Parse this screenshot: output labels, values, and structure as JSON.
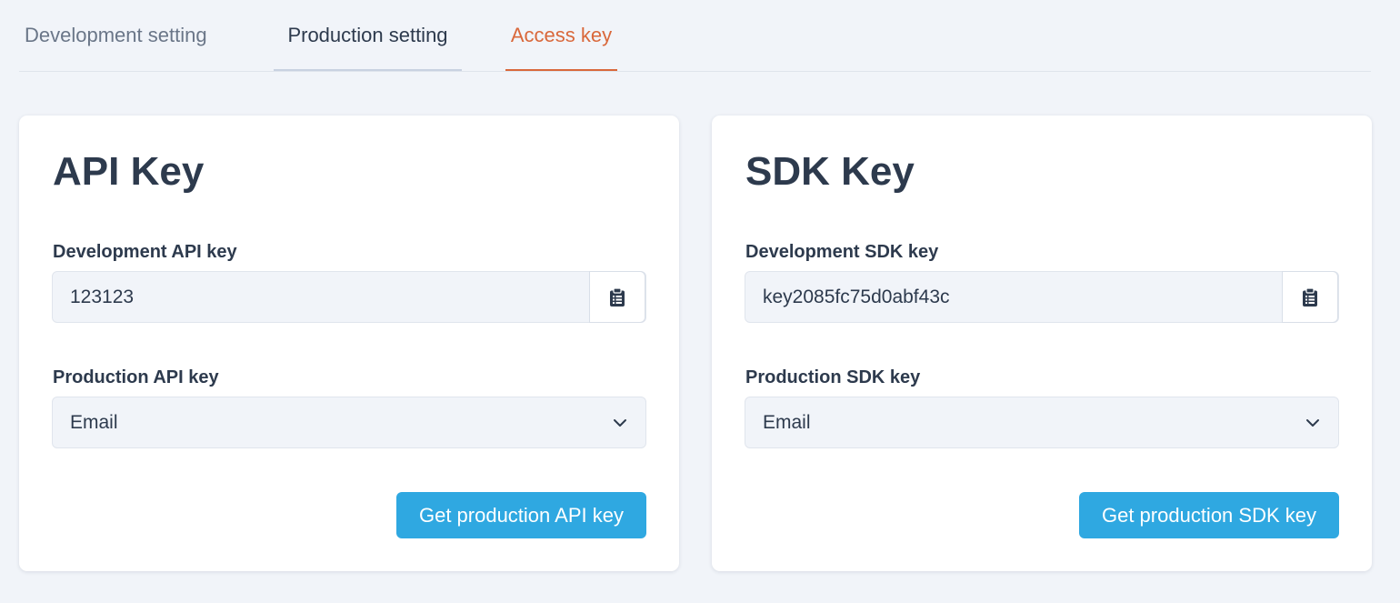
{
  "tabs": [
    {
      "label": "Development setting",
      "active": false
    },
    {
      "label": "Production setting",
      "active": false
    },
    {
      "label": "Access key",
      "active": true
    }
  ],
  "api_card": {
    "title": "API Key",
    "dev_label": "Development API key",
    "dev_value": "123123",
    "prod_label": "Production API key",
    "prod_selected": "Email",
    "button_label": "Get production API key"
  },
  "sdk_card": {
    "title": "SDK Key",
    "dev_label": "Development SDK key",
    "dev_value": "key2085fc75d0abf43c",
    "prod_label": "Production SDK key",
    "prod_selected": "Email",
    "button_label": "Get production SDK key"
  },
  "icons": {
    "copy": "clipboard-icon",
    "dropdown": "chevron-down-icon"
  },
  "colors": {
    "active_tab": "#d9683b",
    "primary_button": "#2fa8e1",
    "background": "#f1f4f9",
    "text": "#2d3a4d"
  }
}
